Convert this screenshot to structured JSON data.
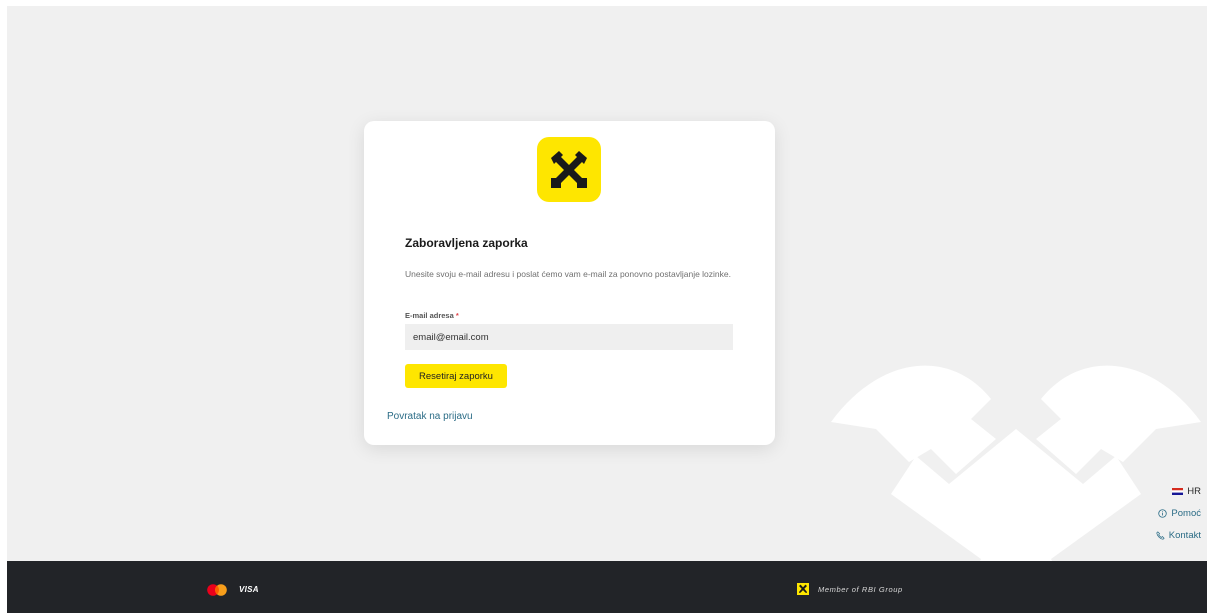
{
  "card": {
    "title": "Zaboravljena zaporka",
    "description": "Unesite svoju e-mail adresu i poslat ćemo vam e-mail za ponovno postavljanje lozinke.",
    "email_label": "E-mail adresa",
    "required_mark": "*",
    "email_value": "email@email.com",
    "reset_button": "Resetiraj zaporku",
    "back_link": "Povratak na prijavu"
  },
  "side": {
    "language": "HR",
    "help": "Pomoć",
    "contact": "Kontakt"
  },
  "footer": {
    "card_brand": "VISA",
    "member_text": "Member of RBI Group"
  },
  "colors": {
    "brand_yellow": "#fee600",
    "link": "#2b6c86",
    "footer_bg": "#222428",
    "page_bg": "#f0f0f0"
  },
  "icons": {
    "logo": "raiffeisen-crossed-horse-heads-icon",
    "flag": "croatia-flag-icon",
    "help": "info-circle-icon",
    "contact": "phone-icon",
    "mastercard": "mastercard-icon"
  }
}
